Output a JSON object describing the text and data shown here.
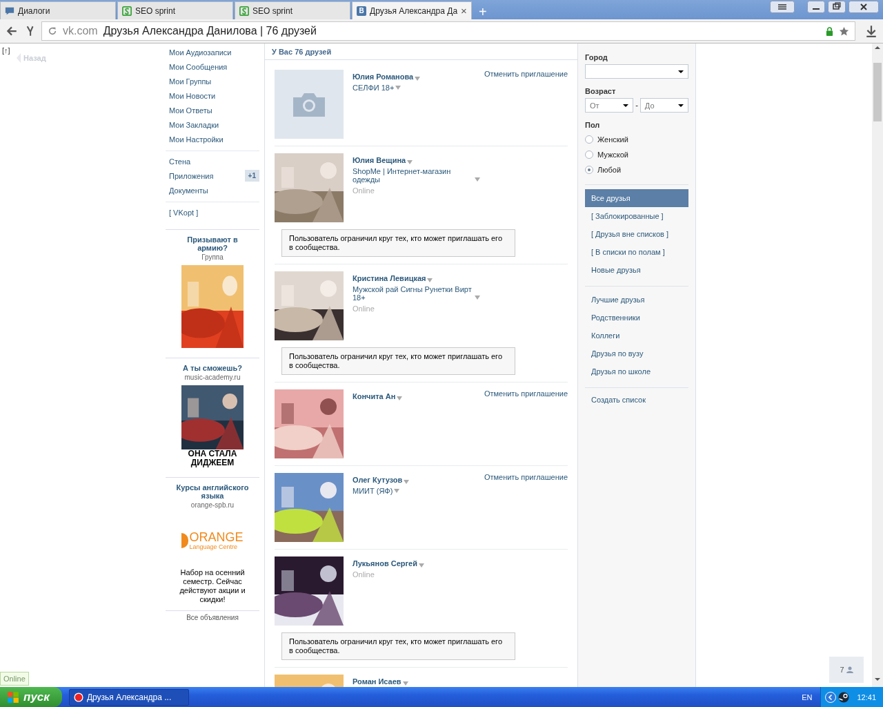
{
  "browser": {
    "tabs": [
      {
        "title": "Диалоги",
        "kind": "chat",
        "selected": false
      },
      {
        "title": "SEO sprint",
        "kind": "seo",
        "selected": false
      },
      {
        "title": "SEO sprint",
        "kind": "seo",
        "selected": false
      },
      {
        "title": "Друзья Александра Да",
        "kind": "vk",
        "icon_letter": "В",
        "selected": true
      }
    ],
    "new_tab": "+",
    "close": "×",
    "address": {
      "domain": "vk.com",
      "title": "Друзья Александра Данилова | 76 друзей"
    }
  },
  "left": {
    "up_link": "[↑]",
    "back": "Назад",
    "nav": [
      [
        {
          "label": "Мои Аудиозаписи"
        },
        {
          "label": "Мои Сообщения"
        },
        {
          "label": "Мои Группы"
        },
        {
          "label": "Мои Новости"
        },
        {
          "label": "Мои Ответы"
        },
        {
          "label": "Мои Закладки"
        },
        {
          "label": "Мои Настройки"
        }
      ],
      [
        {
          "label": "Стена"
        },
        {
          "label": "Приложения",
          "badge": "+1"
        },
        {
          "label": "Документы"
        }
      ],
      [
        {
          "label": "[ VKopt ]"
        }
      ]
    ],
    "ads": [
      {
        "title": "Призывают в армию?",
        "subtitle": "Группа",
        "kind": "picture"
      },
      {
        "title": "А ты сможешь?",
        "subtitle": "music-academy.ru",
        "kind": "picture",
        "caption": "ОНА СТАЛА ДИДЖЕЕМ"
      },
      {
        "title": "Курсы английского языка",
        "subtitle": "orange-spb.ru",
        "kind": "logo",
        "logo": "ORANGE",
        "logo_tagline": "Language Centre",
        "text": "Набор на осенний семестр. Сейчас действуют акции и скидки!"
      }
    ],
    "all_ads": "Все объявления"
  },
  "main": {
    "header": "У Вас 76 друзей",
    "friends": [
      {
        "name": "Юлия Романова",
        "subtitle": "СЕЛФИ 18+",
        "kind": "placeholder",
        "action": "Отменить приглашение"
      },
      {
        "name": "Юлия Вещина",
        "subtitle": "ShopMe | Интернет-магазин одежды",
        "kind": "picture",
        "status": "Online",
        "notice": "Пользователь ограничил круг тех, кто может приглашать его в сообщества."
      },
      {
        "name": "Кристина Левицкая",
        "subtitle": "Мужской рай Сигны Рунетки Вирт 18+",
        "kind": "picture",
        "status": "Online",
        "notice": "Пользователь ограничил круг тех, кто может приглашать его в сообщества."
      },
      {
        "name": "Кончита Ан",
        "kind": "picture",
        "action": "Отменить приглашение"
      },
      {
        "name": "Олег Кутузов",
        "subtitle": "МИИТ (ЯФ)",
        "kind": "picture",
        "action": "Отменить приглашение"
      },
      {
        "name": "Лукьянов Сергей",
        "kind": "picture",
        "status": "Online",
        "notice": "Пользователь ограничил круг тех, кто может приглашать его в сообщества."
      },
      {
        "name": "Роман Исаев",
        "kind": "picture"
      }
    ]
  },
  "filters": {
    "city_label": "Город",
    "age_label": "Возраст",
    "age_from": "От",
    "age_dash": "-",
    "age_to": "До",
    "gender_label": "Пол",
    "genders": [
      {
        "label": "Женский",
        "selected": false
      },
      {
        "label": "Мужской",
        "selected": false
      },
      {
        "label": "Любой",
        "selected": true
      }
    ],
    "lists": [
      [
        {
          "label": "Все друзья",
          "selected": true
        },
        {
          "label": "[ Заблокированные ]",
          "selected": false
        },
        {
          "label": "[ Друзья вне списков ]",
          "selected": false
        },
        {
          "label": "[ В списки по полам ]",
          "selected": false
        },
        {
          "label": "Новые друзья",
          "selected": false
        }
      ],
      [
        {
          "label": "Лучшие друзья",
          "selected": false
        },
        {
          "label": "Родственники",
          "selected": false
        },
        {
          "label": "Коллеги",
          "selected": false
        },
        {
          "label": "Друзья по вузу",
          "selected": false
        },
        {
          "label": "Друзья по школе",
          "selected": false
        }
      ],
      [
        {
          "label": "Создать список",
          "selected": false
        }
      ]
    ]
  },
  "online_label": "Online",
  "friends_widget": "7",
  "taskbar": {
    "start": "пуск",
    "task": "Друзья Александра ...",
    "lang": "EN",
    "clock": "12:41"
  }
}
